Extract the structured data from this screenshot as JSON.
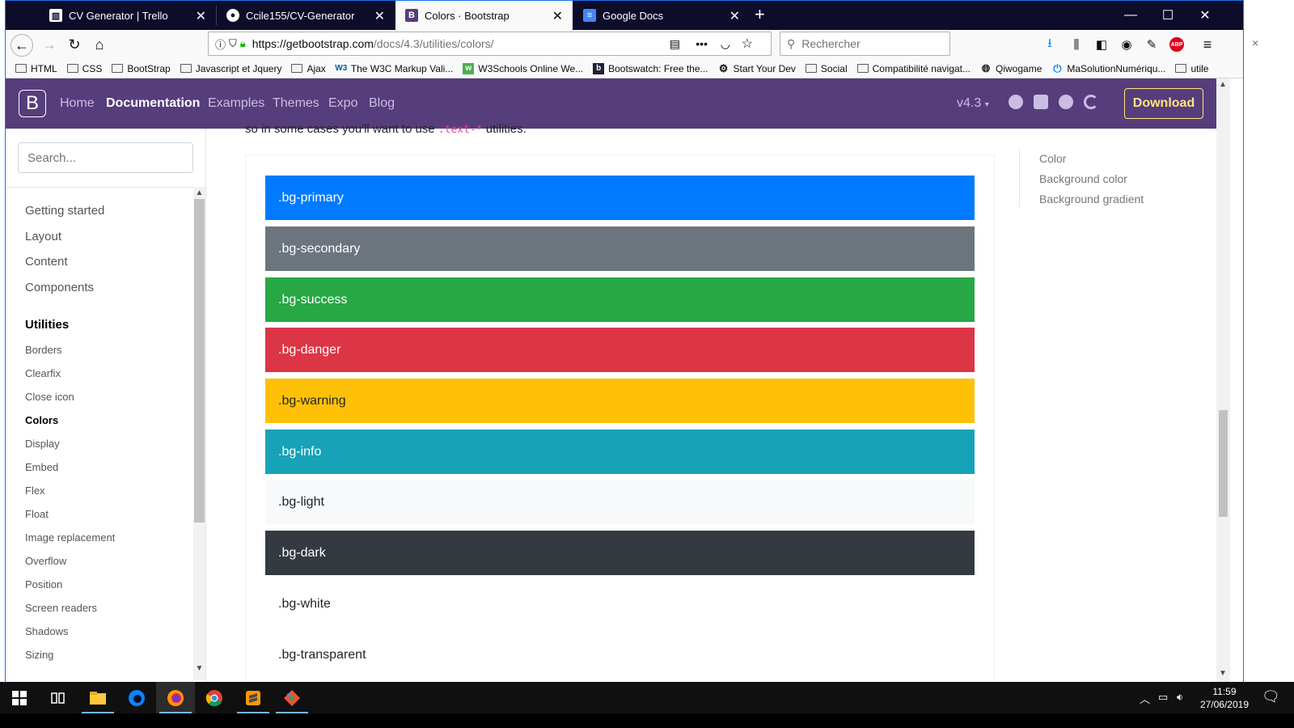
{
  "browser": {
    "tabs": [
      {
        "title": "CV Generator | Trello",
        "icon": "trello-icon",
        "icon_color": "#ffffff"
      },
      {
        "title": "Ccile155/CV-Generator",
        "icon": "github-icon",
        "icon_color": "#ffffff"
      },
      {
        "title": "Colors · Bootstrap",
        "icon": "bootstrap-icon",
        "icon_color": "#563d7c",
        "active": true
      },
      {
        "title": "Google Docs",
        "icon": "google-docs-icon",
        "icon_color": "#4285f4"
      }
    ],
    "new_tab": "+",
    "url_host": "https://getbootstrap.com",
    "url_path": "/docs/4.3/utilities/colors/",
    "search_placeholder": "Rechercher",
    "bookmarks": [
      {
        "label": "HTML",
        "type": "folder"
      },
      {
        "label": "CSS",
        "type": "folder"
      },
      {
        "label": "BootStrap",
        "type": "folder"
      },
      {
        "label": "Javascript et Jquery",
        "type": "folder"
      },
      {
        "label": "Ajax",
        "type": "folder"
      },
      {
        "label": "The W3C Markup Vali...",
        "type": "link",
        "icon": "w3c-icon"
      },
      {
        "label": "W3Schools Online We...",
        "type": "link",
        "icon": "w3schools-icon"
      },
      {
        "label": "Bootswatch: Free the...",
        "type": "link",
        "icon": "bootswatch-icon"
      },
      {
        "label": "Start Your Dev",
        "type": "link",
        "icon": "gear-icon"
      },
      {
        "label": "Social",
        "type": "folder"
      },
      {
        "label": "Compatibilité navigat...",
        "type": "folder"
      },
      {
        "label": "Qiwogame",
        "type": "link",
        "icon": "globe-icon"
      },
      {
        "label": "MaSolutionNumériqu...",
        "type": "link",
        "icon": "power-icon"
      },
      {
        "label": "utile",
        "type": "folder"
      }
    ]
  },
  "site": {
    "logo": "B",
    "nav": [
      "Home",
      "Documentation",
      "Examples",
      "Themes",
      "Expo",
      "Blog"
    ],
    "version": "v4.3",
    "download": "Download",
    "brand_color": "#563d7c"
  },
  "sidebar": {
    "search_placeholder": "Search...",
    "groups": [
      "Getting started",
      "Layout",
      "Content",
      "Components",
      "Utilities"
    ],
    "items": [
      "Borders",
      "Clearfix",
      "Close icon",
      "Colors",
      "Display",
      "Embed",
      "Flex",
      "Float",
      "Image replacement",
      "Overflow",
      "Position",
      "Screen readers",
      "Shadows",
      "Sizing"
    ],
    "active_item": "Colors"
  },
  "content": {
    "intro_prefix": "so in some cases you'll want to use",
    "intro_code": ".text-*",
    "intro_suffix": "utilities.",
    "swatches": [
      {
        "label": ".bg-primary",
        "bg": "#007bff",
        "fg": "#ffffff"
      },
      {
        "label": ".bg-secondary",
        "bg": "#6c757d",
        "fg": "#ffffff"
      },
      {
        "label": ".bg-success",
        "bg": "#28a745",
        "fg": "#ffffff"
      },
      {
        "label": ".bg-danger",
        "bg": "#dc3545",
        "fg": "#ffffff"
      },
      {
        "label": ".bg-warning",
        "bg": "#ffc107",
        "fg": "#212529"
      },
      {
        "label": ".bg-info",
        "bg": "#17a2b8",
        "fg": "#ffffff"
      },
      {
        "label": ".bg-light",
        "bg": "#f8f9fa",
        "fg": "#212529"
      },
      {
        "label": ".bg-dark",
        "bg": "#343a40",
        "fg": "#ffffff"
      },
      {
        "label": ".bg-white",
        "bg": "#ffffff",
        "fg": "#212529"
      },
      {
        "label": ".bg-transparent",
        "bg": "transparent",
        "fg": "#212529"
      }
    ]
  },
  "toc": [
    "Color",
    "Background color",
    "Background gradient"
  ],
  "taskbar": {
    "time": "11:59",
    "date": "27/06/2019"
  }
}
